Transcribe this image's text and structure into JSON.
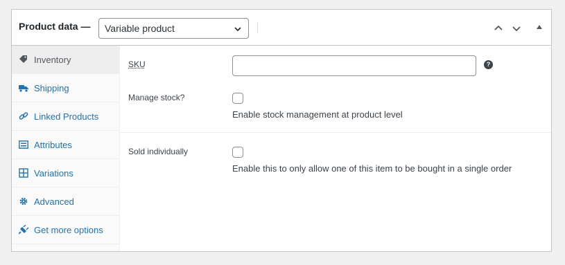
{
  "header": {
    "title": "Product data —",
    "product_type": "Variable product"
  },
  "tabs": [
    {
      "label": "Inventory",
      "icon": "tag-icon",
      "active": true
    },
    {
      "label": "Shipping",
      "icon": "truck-icon"
    },
    {
      "label": "Linked Products",
      "icon": "link-icon"
    },
    {
      "label": "Attributes",
      "icon": "list-icon"
    },
    {
      "label": "Variations",
      "icon": "grid-icon"
    },
    {
      "label": "Advanced",
      "icon": "gear-icon"
    },
    {
      "label": "Get more options",
      "icon": "plugin-icon"
    }
  ],
  "inventory": {
    "sku_label": "SKU",
    "sku_value": "",
    "help_symbol": "?",
    "manage_stock_label": "Manage stock?",
    "manage_stock_desc": "Enable stock management at product level",
    "sold_individually_label": "Sold individually",
    "sold_individually_desc": "Enable this to only allow one of this item to be bought in a single order"
  },
  "colors": {
    "link": "#2271b1",
    "border": "#c3c4c7",
    "background": "#f0f0f1"
  }
}
